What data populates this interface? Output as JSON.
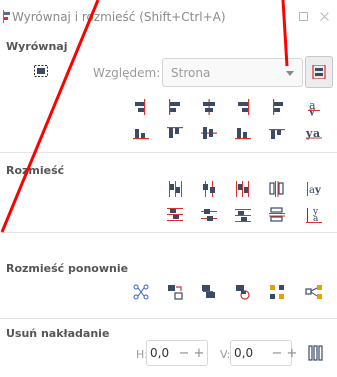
{
  "window": {
    "title": "Wyrównaj i rozmieść (Shift+Ctrl+A)",
    "minimize_icon": "minimize-icon",
    "close_icon": "close-icon"
  },
  "align": {
    "heading": "Wyrównaj",
    "relative_label": "Względem:",
    "relative_value": "Strona",
    "row1_icons": [
      "align-right-edges-to-left-icon",
      "align-left-edges-icon",
      "center-vertical-axis-icon",
      "align-right-edges-icon",
      "align-left-edges-to-right-icon",
      "align-baseline-vertical-text-icon"
    ],
    "row2_icons": [
      "align-bottom-to-top-icon",
      "align-top-edges-icon",
      "center-horizontal-axis-icon",
      "align-bottom-edges-icon",
      "align-top-to-bottom-icon",
      "align-baseline-horizontal-text-icon"
    ]
  },
  "distribute": {
    "heading": "Rozmieść"
  },
  "rearrange": {
    "heading": "Rozmieść ponownie"
  },
  "overlap": {
    "heading": "Usuń nakładanie",
    "h_label": "H:",
    "h_value": "0,0",
    "v_label": "V:",
    "v_value": "0,0",
    "minus": "−",
    "plus": "+"
  },
  "colors": {
    "icon_dark": "#3b4a66",
    "icon_red": "#d9302a",
    "icon_blue": "#3a5fcd",
    "annotation_red": "#ff0000"
  }
}
